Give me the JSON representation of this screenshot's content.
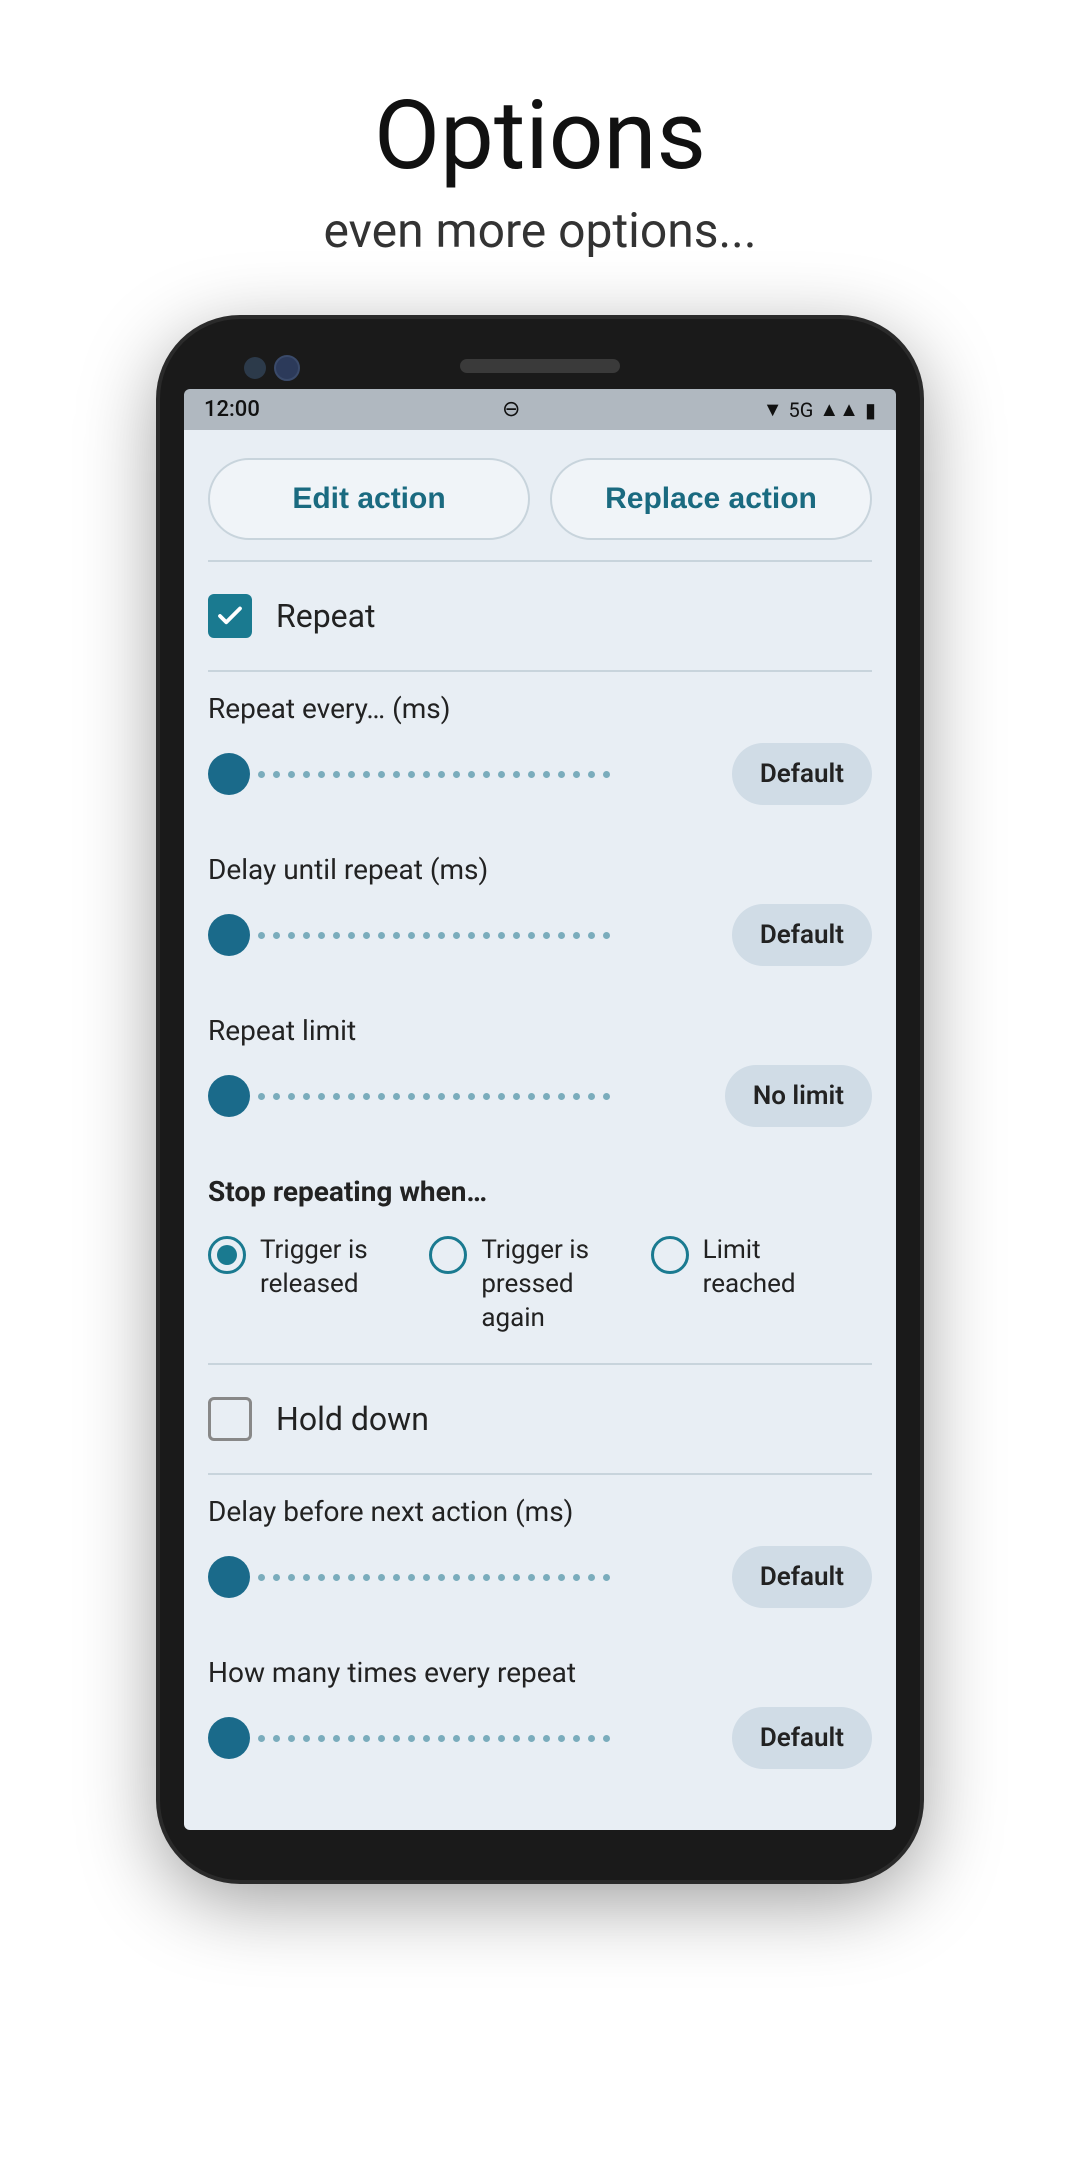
{
  "header": {
    "title": "Options",
    "subtitle": "even more options..."
  },
  "statusBar": {
    "time": "12:00",
    "network": "5G",
    "signal": "▲▲",
    "battery": "🔋"
  },
  "actionButtons": {
    "edit": "Edit action",
    "replace": "Replace action"
  },
  "repeatSection": {
    "checkboxLabel": "Repeat",
    "checked": true
  },
  "repeatEvery": {
    "label": "Repeat every… (ms)",
    "value": "Default"
  },
  "delayUntilRepeat": {
    "label": "Delay until repeat (ms)",
    "value": "Default"
  },
  "repeatLimit": {
    "label": "Repeat limit",
    "value": "No limit"
  },
  "stopRepeating": {
    "groupLabel": "Stop repeating when…",
    "options": [
      {
        "label": "Trigger is\nreleased",
        "selected": true
      },
      {
        "label": "Trigger is pressed\nagain",
        "selected": false
      },
      {
        "label": "Limit\nreached",
        "selected": false
      }
    ]
  },
  "holdDown": {
    "checkboxLabel": "Hold down",
    "checked": false
  },
  "delayBeforeNext": {
    "label": "Delay before next action (ms)",
    "value": "Default"
  },
  "howManyTimes": {
    "label": "How many times every repeat",
    "value": "Default"
  },
  "sliderDots": 24
}
